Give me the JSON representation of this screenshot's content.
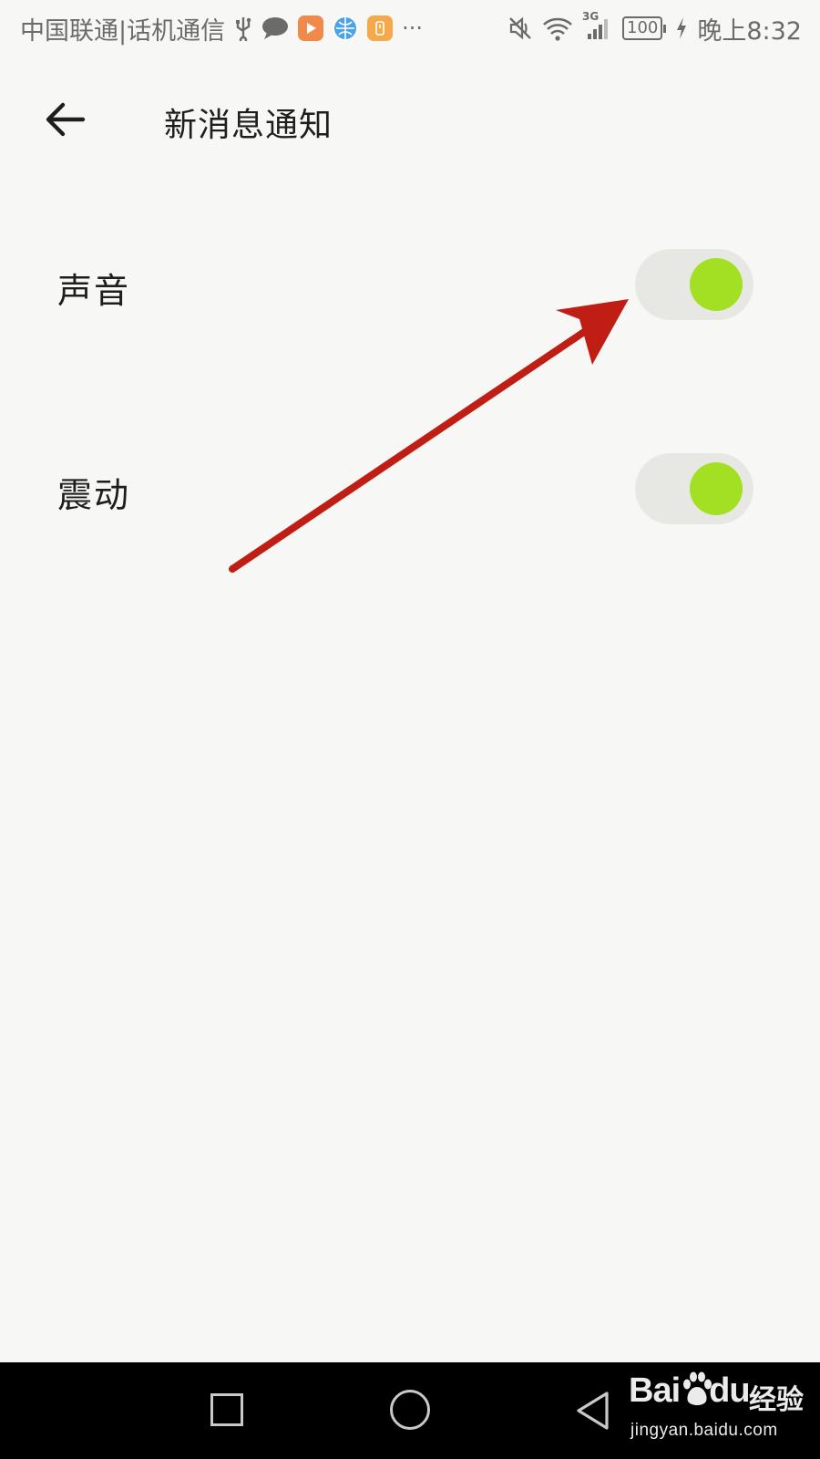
{
  "status_bar": {
    "carrier": "中国联通|话机通信",
    "more": "···",
    "network": "3G",
    "battery": "100",
    "time": "晚上8:32",
    "icons": [
      "usb-icon",
      "chat-bubble-icon",
      "video-app-icon",
      "browser-app-icon",
      "files-app-icon",
      "mute-icon",
      "wifi-icon",
      "signal-icon",
      "charging-icon"
    ]
  },
  "header": {
    "title": "新消息通知",
    "back_icon": "arrow-left-icon"
  },
  "settings": [
    {
      "label": "声音",
      "enabled": true
    },
    {
      "label": "震动",
      "enabled": true
    }
  ],
  "colors": {
    "background": "#f7f7f5",
    "toggle_track": "#e7e8e4",
    "toggle_knob_on": "#a3df22",
    "annotation_arrow": "#c01e14",
    "navbar": "#000000"
  },
  "watermark": {
    "logo": "Bai",
    "logo_suffix": "du",
    "text": "经验",
    "url": "jingyan.baidu.com"
  }
}
